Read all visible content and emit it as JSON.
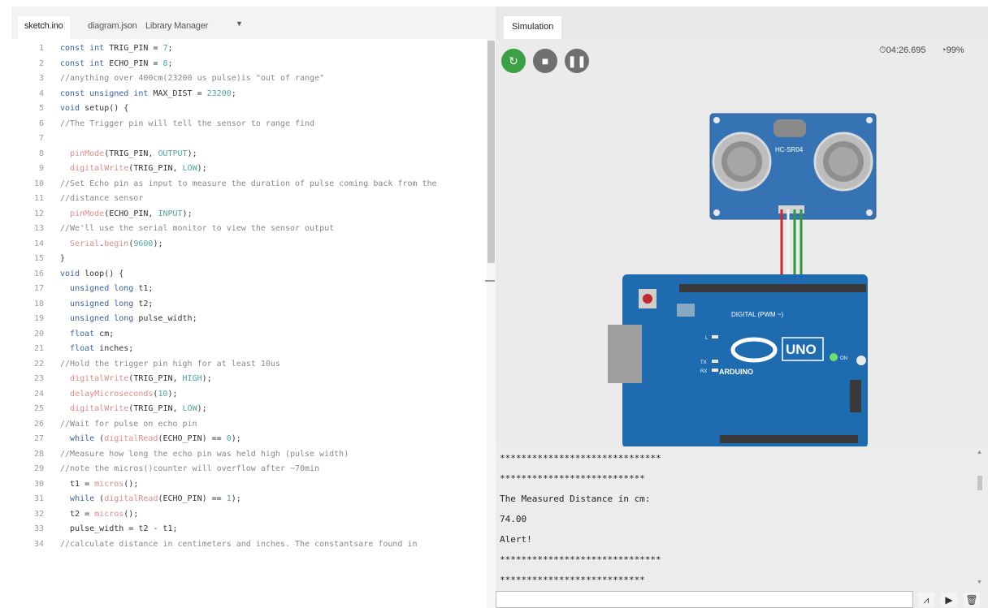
{
  "editor": {
    "tabs": [
      "sketch.ino",
      "diagram.json",
      "Library Manager"
    ],
    "tab_menu_icon": "chevron-down-icon",
    "lines": [
      {
        "n": "1",
        "segs": [
          [
            "k",
            "const int "
          ],
          [
            "p",
            "TRIG_PIN = "
          ],
          [
            "c",
            "7"
          ],
          [
            "p",
            ";"
          ]
        ]
      },
      {
        "n": "2",
        "segs": [
          [
            "k",
            "const int "
          ],
          [
            "p",
            "ECHO_PIN = "
          ],
          [
            "c",
            "8"
          ],
          [
            "p",
            ";"
          ]
        ]
      },
      {
        "n": "3",
        "segs": [
          [
            "m",
            "//anything over 400cm(23200 us pulse)is \"out of range\""
          ]
        ]
      },
      {
        "n": "4",
        "segs": [
          [
            "k",
            "const unsigned int "
          ],
          [
            "p",
            "MAX_DIST = "
          ],
          [
            "c",
            "23200"
          ],
          [
            "p",
            ";"
          ]
        ]
      },
      {
        "n": "5",
        "segs": [
          [
            "k",
            "void "
          ],
          [
            "p",
            "setup() {"
          ]
        ]
      },
      {
        "n": "6",
        "segs": [
          [
            "m",
            "//The Trigger pin will tell the sensor to range find"
          ]
        ]
      },
      {
        "n": "7",
        "segs": []
      },
      {
        "n": "8",
        "segs": [
          [
            "p",
            "  "
          ],
          [
            "f",
            "pinMode"
          ],
          [
            "p",
            "(TRIG_PIN, "
          ],
          [
            "c",
            "OUTPUT"
          ],
          [
            "p",
            ");"
          ]
        ]
      },
      {
        "n": "9",
        "segs": [
          [
            "p",
            "  "
          ],
          [
            "f",
            "digitalWrite"
          ],
          [
            "p",
            "(TRIG_PIN, "
          ],
          [
            "c",
            "LOW"
          ],
          [
            "p",
            ");"
          ]
        ]
      },
      {
        "n": "10",
        "segs": [
          [
            "m",
            "//Set Echo pin as input to measure the duration of pulse coming back from the"
          ]
        ]
      },
      {
        "n": "11",
        "segs": [
          [
            "m",
            "//distance sensor"
          ]
        ]
      },
      {
        "n": "12",
        "segs": [
          [
            "p",
            "  "
          ],
          [
            "f",
            "pinMode"
          ],
          [
            "p",
            "(ECHO_PIN, "
          ],
          [
            "c",
            "INPUT"
          ],
          [
            "p",
            ");"
          ]
        ]
      },
      {
        "n": "13",
        "segs": [
          [
            "m",
            "//We'll use the serial monitor to view the sensor output"
          ]
        ]
      },
      {
        "n": "14",
        "segs": [
          [
            "p",
            "  "
          ],
          [
            "f",
            "Serial"
          ],
          [
            "p",
            "."
          ],
          [
            "f",
            "begin"
          ],
          [
            "p",
            "("
          ],
          [
            "c",
            "9600"
          ],
          [
            "p",
            ");"
          ]
        ]
      },
      {
        "n": "15",
        "segs": [
          [
            "p",
            "}"
          ]
        ]
      },
      {
        "n": "16",
        "segs": [
          [
            "k",
            "void "
          ],
          [
            "p",
            "loop() {"
          ]
        ]
      },
      {
        "n": "17",
        "segs": [
          [
            "p",
            "  "
          ],
          [
            "k",
            "unsigned long "
          ],
          [
            "p",
            "t1;"
          ]
        ]
      },
      {
        "n": "18",
        "segs": [
          [
            "p",
            "  "
          ],
          [
            "k",
            "unsigned long "
          ],
          [
            "p",
            "t2;"
          ]
        ]
      },
      {
        "n": "19",
        "segs": [
          [
            "p",
            "  "
          ],
          [
            "k",
            "unsigned long "
          ],
          [
            "p",
            "pulse_width;"
          ]
        ]
      },
      {
        "n": "20",
        "segs": [
          [
            "p",
            "  "
          ],
          [
            "k",
            "float "
          ],
          [
            "p",
            "cm;"
          ]
        ]
      },
      {
        "n": "21",
        "segs": [
          [
            "p",
            "  "
          ],
          [
            "k",
            "float "
          ],
          [
            "p",
            "inches;"
          ]
        ]
      },
      {
        "n": "22",
        "segs": [
          [
            "m",
            "//Hold the trigger pin high for at least 10us"
          ]
        ]
      },
      {
        "n": "23",
        "segs": [
          [
            "p",
            "  "
          ],
          [
            "f",
            "digitalWrite"
          ],
          [
            "p",
            "(TRIG_PIN, "
          ],
          [
            "c",
            "HIGH"
          ],
          [
            "p",
            ");"
          ]
        ]
      },
      {
        "n": "24",
        "segs": [
          [
            "p",
            "  "
          ],
          [
            "f",
            "delayMicroseconds"
          ],
          [
            "p",
            "("
          ],
          [
            "c",
            "10"
          ],
          [
            "p",
            ");"
          ]
        ]
      },
      {
        "n": "25",
        "segs": [
          [
            "p",
            "  "
          ],
          [
            "f",
            "digitalWrite"
          ],
          [
            "p",
            "(TRIG_PIN, "
          ],
          [
            "c",
            "LOW"
          ],
          [
            "p",
            ");"
          ]
        ]
      },
      {
        "n": "26",
        "segs": [
          [
            "m",
            "//Wait for pulse on echo pin"
          ]
        ]
      },
      {
        "n": "27",
        "segs": [
          [
            "p",
            "  "
          ],
          [
            "k",
            "while "
          ],
          [
            "p",
            "("
          ],
          [
            "f",
            "digitalRead"
          ],
          [
            "p",
            "(ECHO_PIN) == "
          ],
          [
            "c",
            "0"
          ],
          [
            "p",
            ");"
          ]
        ]
      },
      {
        "n": "28",
        "segs": [
          [
            "m",
            "//Measure how long the echo pin was held high (pulse width)"
          ]
        ]
      },
      {
        "n": "29",
        "segs": [
          [
            "m",
            "//note the micros()counter will overflow after ~70min"
          ]
        ]
      },
      {
        "n": "30",
        "segs": [
          [
            "p",
            "  t1 = "
          ],
          [
            "f",
            "micros"
          ],
          [
            "p",
            "();"
          ]
        ]
      },
      {
        "n": "31",
        "segs": [
          [
            "p",
            "  "
          ],
          [
            "k",
            "while "
          ],
          [
            "p",
            "("
          ],
          [
            "f",
            "digitalRead"
          ],
          [
            "p",
            "(ECHO_PIN) == "
          ],
          [
            "c",
            "1"
          ],
          [
            "p",
            ");"
          ]
        ]
      },
      {
        "n": "32",
        "segs": [
          [
            "p",
            "  t2 = "
          ],
          [
            "f",
            "micros"
          ],
          [
            "p",
            "();"
          ]
        ]
      },
      {
        "n": "33",
        "segs": [
          [
            "p",
            "  pulse_width = t2 - t1;"
          ]
        ]
      },
      {
        "n": "34",
        "segs": [
          [
            "m",
            "//calculate distance in centimeters and inches. The constantsare found in"
          ]
        ]
      }
    ]
  },
  "simulation": {
    "tab_label": "Simulation",
    "controls": {
      "restart_icon": "restart-icon",
      "stop_icon": "stop-icon",
      "pause_icon": "pause-icon"
    },
    "timer": "04:26.695",
    "speed": "99%",
    "sensor_label": "HC-SR04",
    "board": {
      "logo_text": "UNO",
      "brand_text": "ARDUINO",
      "digital_label": "DIGITAL (PWM ~)",
      "led_labels": [
        "L",
        "TX",
        "RX",
        "ON"
      ]
    },
    "wire_colors": {
      "red": "#d8262a",
      "green": "#2c9a3a",
      "black": "#222222",
      "white": "#f2f2f2"
    },
    "board_color": "#1f6bb0",
    "sensor_color": "#3573b5",
    "accent_green": "#3aa244"
  },
  "serial": {
    "lines": [
      "******************************",
      "***************************",
      "The Measured Distance in cm:",
      "74.00",
      "Alert!",
      "******************************",
      "***************************"
    ],
    "plotter_icon": "plotter-icon",
    "play_icon": "play-icon",
    "clear_icon": "trash-icon"
  }
}
